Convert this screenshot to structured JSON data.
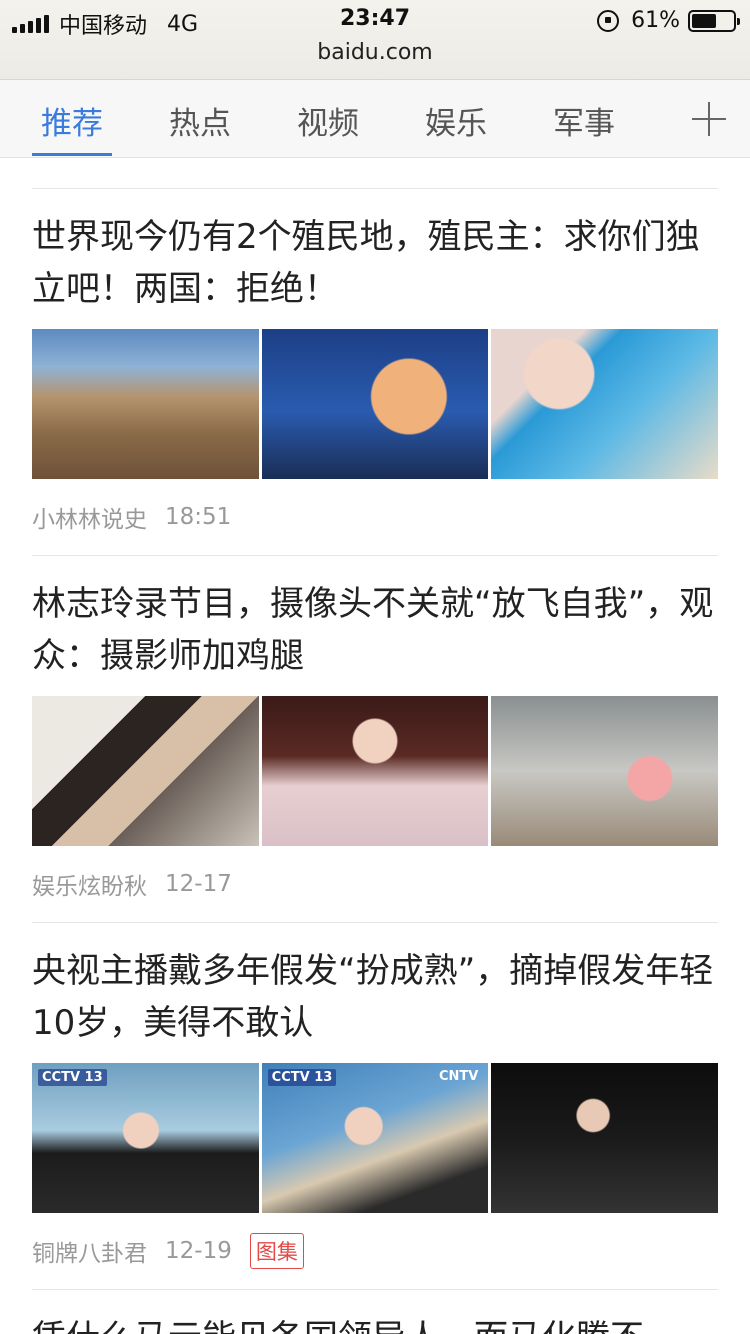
{
  "status_bar": {
    "carrier": "中国移动",
    "network": "4G",
    "time": "23:47",
    "url": "baidu.com",
    "battery": "61%",
    "battery_level": 0.61
  },
  "tabs": {
    "items": [
      "推荐",
      "热点",
      "视频",
      "娱乐",
      "军事"
    ],
    "active_index": 0,
    "accent_color": "#3a7bdc",
    "add_icon": "plus-icon"
  },
  "feed": {
    "articles": [
      {
        "title": "世界现今仍有2个殖民地，殖民主：求你们独立吧！两国：拒绝！",
        "source": "小林林说史",
        "time": "18:51",
        "badge": ""
      },
      {
        "title": "林志玲录节目，摄像头不关就“放飞自我”，观众：摄影师加鸡腿",
        "source": "娱乐炫盼秋",
        "time": "12-17",
        "badge": ""
      },
      {
        "title": "央视主播戴多年假发“扮成熟”，摘掉假发年轻10岁，美得不敢认",
        "source": "铜牌八卦君",
        "time": "12-19",
        "badge": "图集",
        "thumb_logos": [
          "CCTV 13",
          "CCTV 13",
          "CNTV"
        ]
      },
      {
        "title": "凭什么马云能见各国领导人，而马化腾不"
      }
    ]
  }
}
